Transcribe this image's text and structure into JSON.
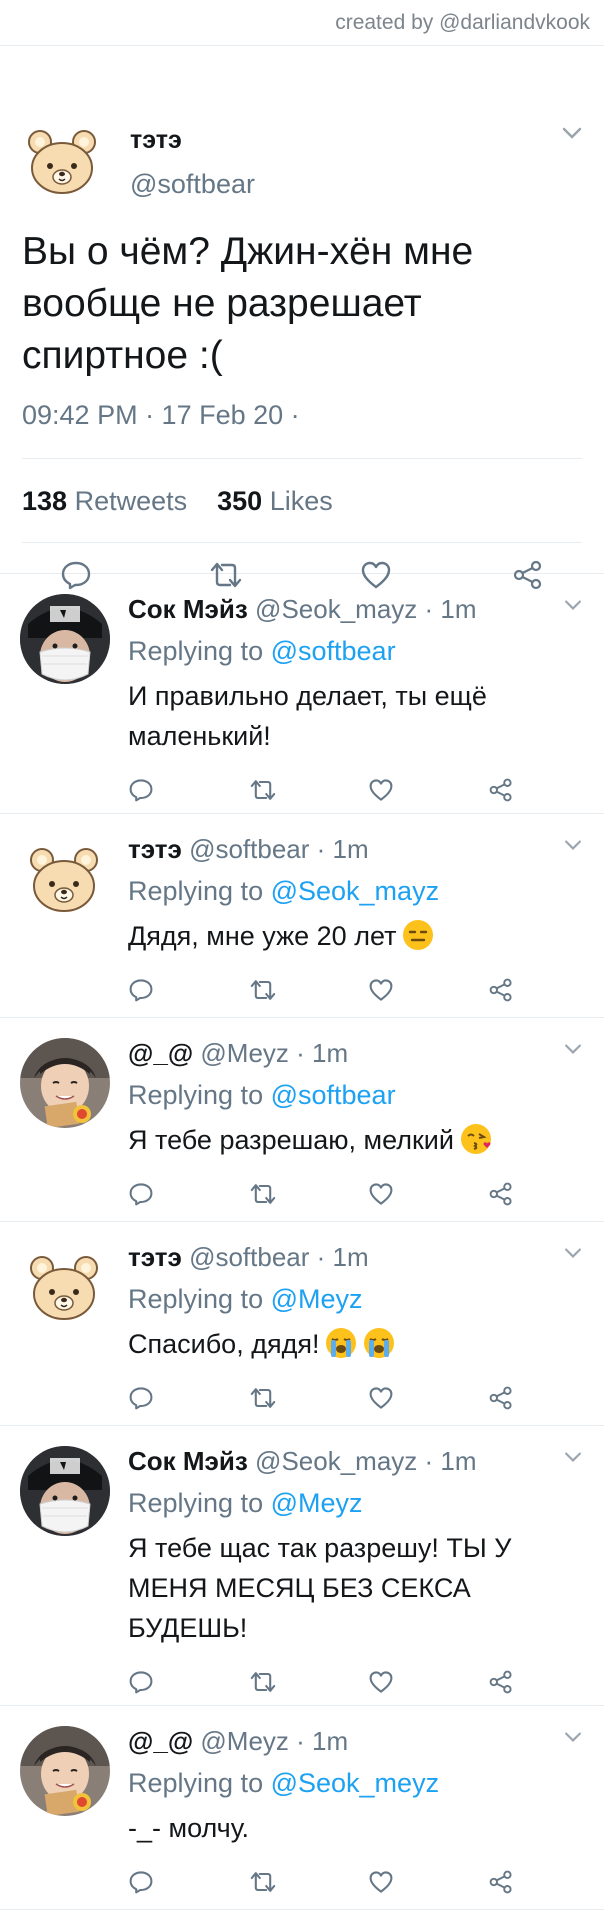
{
  "credit": "created by @darliandvkook",
  "main_tweet": {
    "name": "тэтэ",
    "handle": "@softbear",
    "text": "Вы о чём? Джин-хён мне вообще не разрешает спиртное :(",
    "time": "09:42 PM · 17 Feb 20 ·",
    "retweets_count": "138",
    "retweets_label": " Retweets",
    "likes_count": "350",
    "likes_label": " Likes"
  },
  "replies": [
    {
      "name": "Сок Мэйз",
      "handle": " @Seok_mayz · 1m",
      "replying_prefix": "Replying to ",
      "replying_to": "@softbear",
      "text": "И правильно делает, ты ещё маленький!",
      "avatar": "masked-person-avatar"
    },
    {
      "name": "тэтэ",
      "handle": " @softbear · 1m",
      "replying_prefix": "Replying to ",
      "replying_to": "@Seok_mayz",
      "text": "Дядя, мне уже 20 лет",
      "avatar": "bear-avatar",
      "emoji": [
        "expressionless-face"
      ]
    },
    {
      "name": "@_@",
      "handle": " @Meyz · 1m",
      "replying_prefix": "Replying to ",
      "replying_to": "@softbear",
      "text": "Я тебе разрешаю, мелкий",
      "avatar": "smiling-person-avatar",
      "emoji": [
        "face-blowing-kiss"
      ]
    },
    {
      "name": "тэтэ",
      "handle": " @softbear · 1m",
      "replying_prefix": "Replying to ",
      "replying_to": "@Meyz",
      "text": "Спасибо, дядя!",
      "avatar": "bear-avatar",
      "emoji": [
        "loudly-crying-face",
        "loudly-crying-face"
      ]
    },
    {
      "name": "Сок Мэйз",
      "handle": " @Seok_mayz · 1m",
      "replying_prefix": "Replying to ",
      "replying_to": "@Meyz",
      "text": "Я тебе щас так разрешу! ТЫ У МЕНЯ МЕСЯЦ БЕЗ СЕКСА БУДЕШЬ!",
      "avatar": "masked-person-avatar"
    },
    {
      "name": "@_@",
      "handle": " @Meyz · 1m",
      "replying_prefix": "Replying to ",
      "replying_to": "@Seok_meyz",
      "text": "-_- молчу.",
      "avatar": "smiling-person-avatar"
    }
  ],
  "icons": [
    "reply-icon",
    "retweet-icon",
    "like-icon",
    "share-icon",
    "chevron-down-icon"
  ],
  "colors": {
    "link": "#1da1f2",
    "secondary_text": "#657786",
    "divider": "#e6ecf0",
    "icon": "#657786"
  }
}
